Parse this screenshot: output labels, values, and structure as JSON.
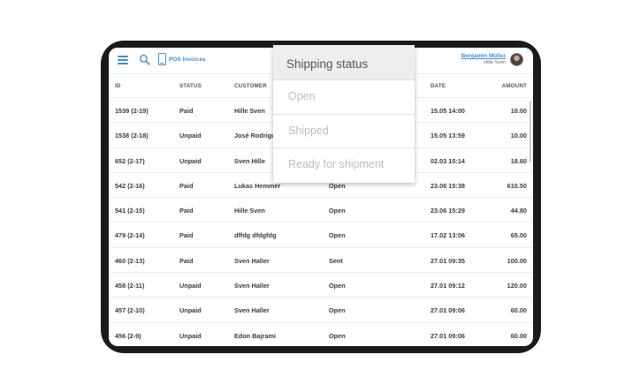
{
  "header": {
    "app_title": "POS Invoices",
    "user_name": "Benjamin Müller",
    "user_location": "Hille Sven"
  },
  "table": {
    "columns": [
      "ID",
      "STATUS",
      "CUSTOMER",
      "DATE",
      "AMOUNT"
    ],
    "rows": [
      {
        "id": "1539 (2-19)",
        "status": "Paid",
        "customer": "Hille Sven",
        "shipping": "",
        "date": "15.05 14:00",
        "amount": "10.00"
      },
      {
        "id": "1538 (2-18)",
        "status": "Unpaid",
        "customer": "José Rodrigu",
        "shipping": "",
        "date": "15.05 13:59",
        "amount": "10.00"
      },
      {
        "id": "652 (2-17)",
        "status": "Unpaid",
        "customer": "Sven Hille",
        "shipping": "",
        "date": "02.03 15:14",
        "amount": "18.60"
      },
      {
        "id": "542 (2-16)",
        "status": "Paid",
        "customer": "Lukas Hemmer",
        "shipping": "Open",
        "date": "23.06 15:38",
        "amount": "610.50"
      },
      {
        "id": "541 (2-15)",
        "status": "Paid",
        "customer": "Hille Sven",
        "shipping": "Open",
        "date": "23.06 15:29",
        "amount": "44.80"
      },
      {
        "id": "479 (2-14)",
        "status": "Paid",
        "customer": "dffdg dfdgfdg",
        "shipping": "Open",
        "date": "17.02 13:06",
        "amount": "65.00"
      },
      {
        "id": "460 (2-13)",
        "status": "Paid",
        "customer": "Sven Haller",
        "shipping": "Sent",
        "date": "27.01 09:35",
        "amount": "100.00"
      },
      {
        "id": "458 (2-11)",
        "status": "Unpaid",
        "customer": "Sven Haller",
        "shipping": "Open",
        "date": "27.01 09:12",
        "amount": "120.00"
      },
      {
        "id": "457 (2-10)",
        "status": "Unpaid",
        "customer": "Sven Haller",
        "shipping": "Open",
        "date": "27.01 09:06",
        "amount": "60.00"
      },
      {
        "id": "456 (2-9)",
        "status": "Unpaid",
        "customer": "Edon Bajrami",
        "shipping": "Open",
        "date": "27.01 09:06",
        "amount": "60.00"
      }
    ]
  },
  "dropdown": {
    "title": "Shipping status",
    "options": [
      "Open",
      "Shipped",
      "Ready for shipment"
    ]
  },
  "icons": {
    "menu": "menu-icon",
    "search": "search-icon",
    "app": "document-icon",
    "avatar": "user-avatar"
  },
  "colors": {
    "accent": "#3d8ed8",
    "device_frame": "#1b1b1b"
  }
}
